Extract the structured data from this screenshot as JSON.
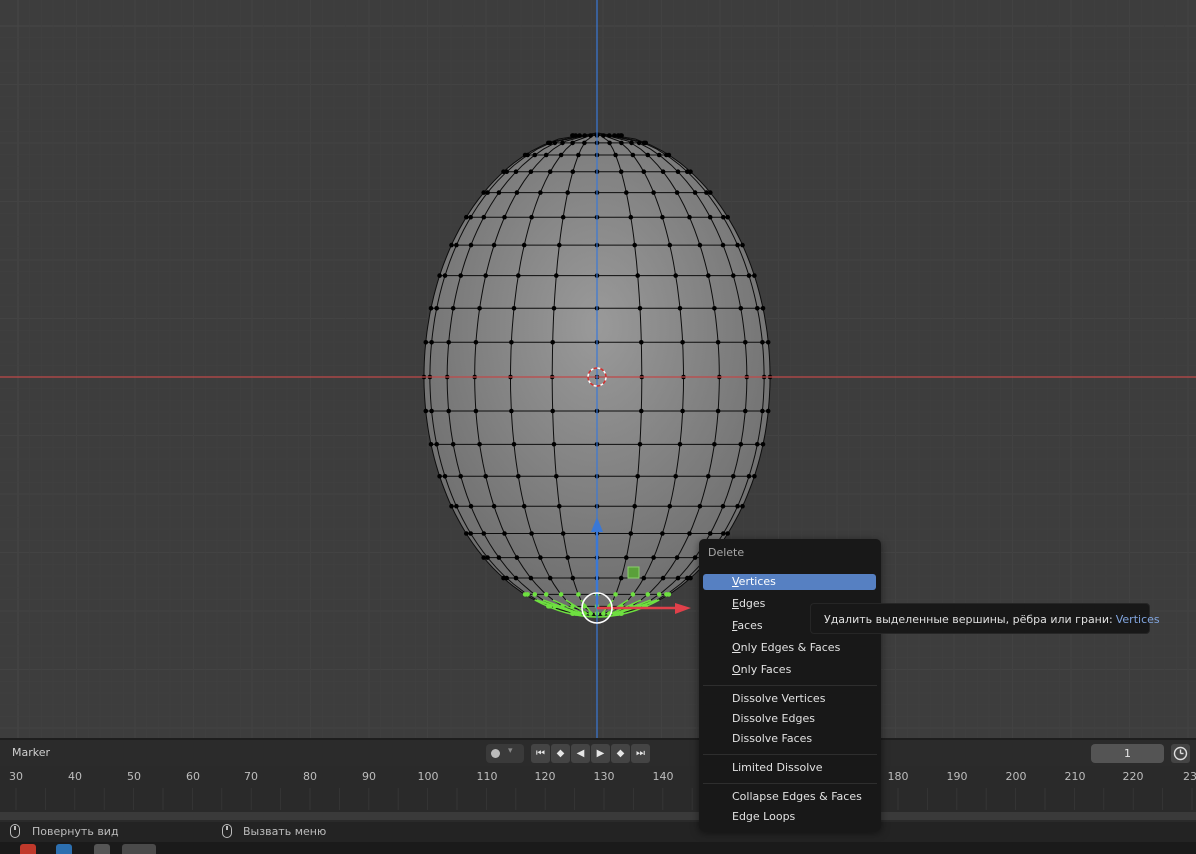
{
  "colors": {
    "viewport_bg": "#3d3d3d",
    "grid_line": "#474747",
    "x_axis": "#c04848",
    "z_axis": "#3a78d6",
    "mesh_fill": "#8e8e8e",
    "mesh_wire": "#0d0d0d",
    "selected": "#6ee040",
    "menu_bg": "#181818",
    "menu_active": "#5680c2"
  },
  "delete_menu": {
    "title": "Delete",
    "items_group1": [
      {
        "label": "Vertices",
        "active": true
      },
      {
        "label": "Edges",
        "active": false
      },
      {
        "label": "Faces",
        "active": false
      },
      {
        "label": "Only Edges & Faces",
        "active": false
      },
      {
        "label": "Only Faces",
        "active": false
      }
    ],
    "items_group2": [
      {
        "label": "Dissolve Vertices"
      },
      {
        "label": "Dissolve Edges"
      },
      {
        "label": "Dissolve Faces"
      }
    ],
    "items_group3": [
      {
        "label": "Limited Dissolve"
      }
    ],
    "items_group4": [
      {
        "label": "Collapse Edges & Faces"
      },
      {
        "label": "Edge Loops"
      }
    ]
  },
  "tooltip": {
    "text": "Удалить выделенные вершины, рёбра или грани:",
    "value": "Vertices"
  },
  "timeline": {
    "marker_label": "Marker",
    "current_frame": "1",
    "ticks": [
      "30",
      "40",
      "50",
      "60",
      "70",
      "80",
      "90",
      "100",
      "110",
      "120",
      "130",
      "140",
      "180",
      "190",
      "200",
      "210",
      "220",
      "23"
    ]
  },
  "statusbar": {
    "left_action": "Повернуть вид",
    "right_action": "Вызвать меню"
  },
  "icons": [
    "mouse-icon",
    "jump-start-icon",
    "prev-keyframe-icon",
    "play-reverse-icon",
    "play-icon",
    "next-keyframe-icon",
    "jump-end-icon",
    "clock-icon",
    "transform-gizmo-icon",
    "3d-cursor-icon"
  ]
}
